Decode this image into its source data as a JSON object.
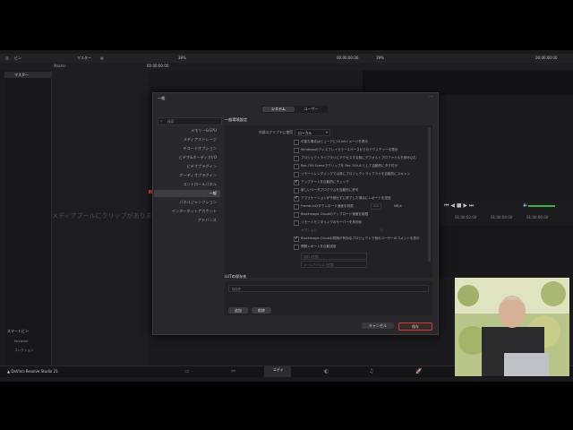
{
  "app": {
    "bin_title": "ビン",
    "master_label": "マスター",
    "master_tab": "マスター",
    "master_header": "Master",
    "zoom": "39%",
    "timecode_left": "00:00:00:00",
    "timecode_center": "00:00:00:00",
    "zoom_right": "39%",
    "timecode_right": "00:00:00:00",
    "empty_media": "メディアプールにクリップがありません",
    "smart_bins": "スマートビン",
    "smart_bin_items": [
      "Keyword",
      "コレクション"
    ],
    "brand": "DaVinci Resolve Studio 21",
    "timeline_times": [
      "01:00:00:00",
      "01:00:02:00",
      "01:00:04:00",
      "01:00:06:00"
    ],
    "bottom_tab_active": "エディ"
  },
  "dialog": {
    "title": "一般",
    "tabs": [
      "システム",
      "ユーザー"
    ],
    "active_tab": "システム",
    "search_placeholder": "検索",
    "nav": [
      "メモリー&GPU",
      "メディアストレージ",
      "デコードオプション",
      "ビデオ&オーディオI/O",
      "ビデオプラグイン",
      "オーディオプラグイン",
      "コントロールパネル",
      "一般",
      "パネルジャンクション",
      "インターネットアカウント",
      "アドバンス"
    ],
    "nav_active": "一般",
    "section_title": "一般環境設定",
    "script_label": "外部スクリプトに使用",
    "script_value": "ローカル",
    "options": [
      {
        "label": "可能な場合はビューアに10-bitイメージを表示",
        "checked": false
      },
      {
        "label": "Windowsのディスプレイカラースペースからのテクスチャーを表示",
        "checked": false
      },
      {
        "label": "プロジェクトライブラリにアクセスする前にデフォルトプロファイルを読み込む",
        "checked": false
      },
      {
        "label": "Rec.709 Sceneでクリップを Rec.709-A として自動的にタグ付け",
        "checked": false
      },
      {
        "label": "リモートレンダリングでは常にプロジェクトライブラリを自動的にスキャン",
        "checked": false
      },
      {
        "label": "アップデートを自動的にチェック",
        "checked": true
      },
      {
        "label": "新しいベータプログラムを自動的に許可",
        "checked": false
      },
      {
        "label": "アプリケーションが予期せずに終了した場合にレポートを送信",
        "checked": true
      },
      {
        "label": "Frame.ioのダウンロード速度を制限",
        "checked": false
      },
      {
        "label": "Blackmagic Cloudのアップロード速度を制限",
        "checked": false
      },
      {
        "label": "リモートモニタリングのサーバーを有効化",
        "checked": false
      },
      {
        "label": "Blackmagic Cloudの同期が有効なプロジェクトで他のユーザーのコメントを表示",
        "checked": true
      },
      {
        "label": "問題レポートを自動送信",
        "checked": false
      }
    ],
    "speed_unit": "MB/s",
    "speed_value": "0.0",
    "options_label": "オプション",
    "name_placeholder": "名前 (任意)",
    "email_placeholder": "メールアドレス (任意)",
    "lut_title": "LUTの保存先",
    "lut_path_placeholder": "保存先",
    "add_button": "追加",
    "remove_button": "削除",
    "cancel_button": "キャンセル",
    "save_button": "保存"
  },
  "colors": {
    "accent_red": "#c2423a",
    "dialog_bg": "#28282b",
    "app_bg": "#1b1b1d",
    "green_meter": "#3fae4a"
  }
}
